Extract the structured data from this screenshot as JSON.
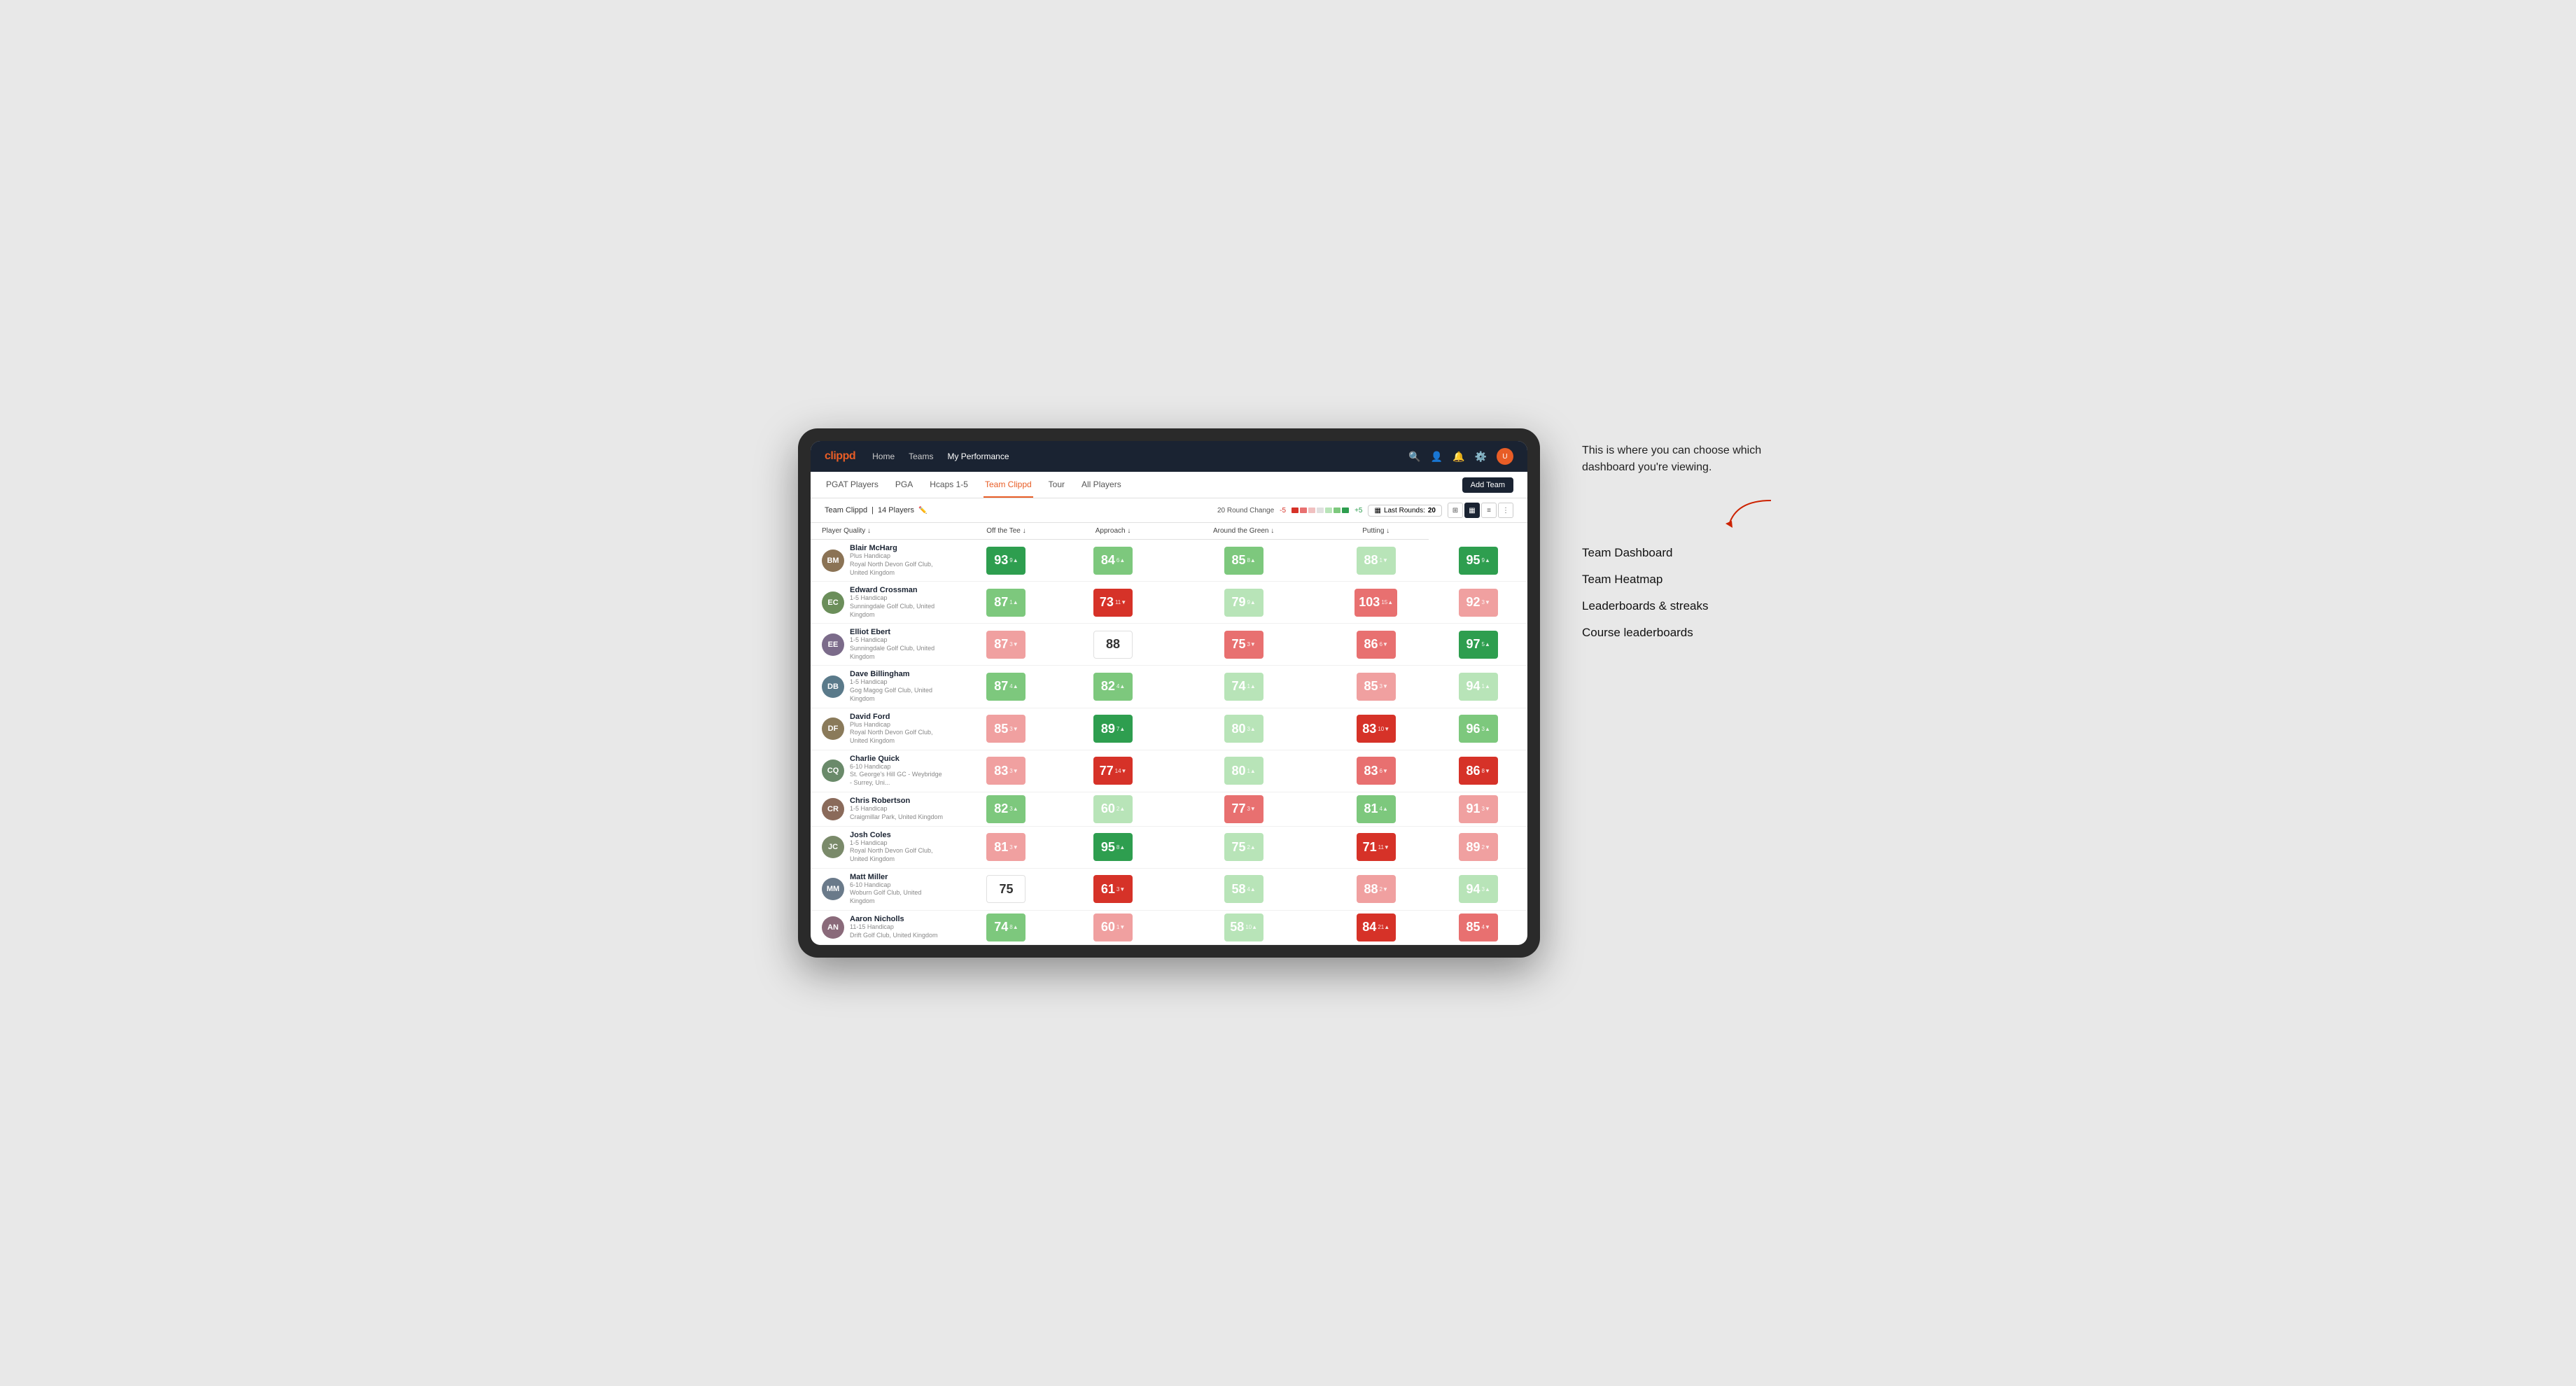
{
  "annotation": {
    "intro_text": "This is where you can choose which dashboard you're viewing.",
    "options": [
      "Team Dashboard",
      "Team Heatmap",
      "Leaderboards & streaks",
      "Course leaderboards"
    ]
  },
  "nav": {
    "logo": "clippd",
    "links": [
      "Home",
      "Teams",
      "My Performance"
    ],
    "active_link": "My Performance"
  },
  "sub_nav": {
    "links": [
      "PGAT Players",
      "PGA",
      "Hcaps 1-5",
      "Team Clippd",
      "Tour",
      "All Players"
    ],
    "active_link": "Team Clippd",
    "add_team_label": "Add Team"
  },
  "team_header": {
    "team_name": "Team Clippd",
    "player_count": "14 Players",
    "round_change_label": "20 Round Change",
    "round_change_low": "-5",
    "round_change_high": "+5",
    "last_rounds_label": "Last Rounds:",
    "last_rounds_value": "20"
  },
  "table": {
    "col_headers": [
      "Player Quality ↓",
      "Off the Tee ↓",
      "Approach ↓",
      "Around the Green ↓",
      "Putting ↓"
    ],
    "rows": [
      {
        "name": "Blair McHarg",
        "handicap": "Plus Handicap",
        "club": "Royal North Devon Golf Club, United Kingdom",
        "initials": "BM",
        "avatar_color": "#8B7355",
        "scores": [
          {
            "value": "93",
            "delta": "9",
            "dir": "up",
            "color": "green-strong"
          },
          {
            "value": "84",
            "delta": "6",
            "dir": "up",
            "color": "green-light"
          },
          {
            "value": "85",
            "delta": "8",
            "dir": "up",
            "color": "green-light"
          },
          {
            "value": "88",
            "delta": "1",
            "dir": "down",
            "color": "green-pale"
          },
          {
            "value": "95",
            "delta": "9",
            "dir": "up",
            "color": "green-strong"
          }
        ]
      },
      {
        "name": "Edward Crossman",
        "handicap": "1-5 Handicap",
        "club": "Sunningdale Golf Club, United Kingdom",
        "initials": "EC",
        "avatar_color": "#6B8E5A",
        "scores": [
          {
            "value": "87",
            "delta": "1",
            "dir": "up",
            "color": "green-light"
          },
          {
            "value": "73",
            "delta": "11",
            "dir": "down",
            "color": "red-strong"
          },
          {
            "value": "79",
            "delta": "9",
            "dir": "up",
            "color": "green-pale"
          },
          {
            "value": "103",
            "delta": "15",
            "dir": "up",
            "color": "red-light"
          },
          {
            "value": "92",
            "delta": "3",
            "dir": "down",
            "color": "red-pale"
          }
        ]
      },
      {
        "name": "Elliot Ebert",
        "handicap": "1-5 Handicap",
        "club": "Sunningdale Golf Club, United Kingdom",
        "initials": "EE",
        "avatar_color": "#7B6B8A",
        "scores": [
          {
            "value": "87",
            "delta": "3",
            "dir": "down",
            "color": "red-pale"
          },
          {
            "value": "88",
            "delta": "",
            "dir": "",
            "color": "white"
          },
          {
            "value": "75",
            "delta": "3",
            "dir": "down",
            "color": "red-light"
          },
          {
            "value": "86",
            "delta": "6",
            "dir": "down",
            "color": "red-light"
          },
          {
            "value": "97",
            "delta": "5",
            "dir": "up",
            "color": "green-strong"
          }
        ]
      },
      {
        "name": "Dave Billingham",
        "handicap": "1-5 Handicap",
        "club": "Gog Magog Golf Club, United Kingdom",
        "initials": "DB",
        "avatar_color": "#5A7A8A",
        "scores": [
          {
            "value": "87",
            "delta": "4",
            "dir": "up",
            "color": "green-light"
          },
          {
            "value": "82",
            "delta": "4",
            "dir": "up",
            "color": "green-light"
          },
          {
            "value": "74",
            "delta": "1",
            "dir": "up",
            "color": "green-pale"
          },
          {
            "value": "85",
            "delta": "3",
            "dir": "down",
            "color": "red-pale"
          },
          {
            "value": "94",
            "delta": "1",
            "dir": "up",
            "color": "green-pale"
          }
        ]
      },
      {
        "name": "David Ford",
        "handicap": "Plus Handicap",
        "club": "Royal North Devon Golf Club, United Kingdom",
        "initials": "DF",
        "avatar_color": "#8A7A5A",
        "scores": [
          {
            "value": "85",
            "delta": "3",
            "dir": "down",
            "color": "red-pale"
          },
          {
            "value": "89",
            "delta": "7",
            "dir": "up",
            "color": "green-strong"
          },
          {
            "value": "80",
            "delta": "3",
            "dir": "up",
            "color": "green-pale"
          },
          {
            "value": "83",
            "delta": "10",
            "dir": "down",
            "color": "red-strong"
          },
          {
            "value": "96",
            "delta": "3",
            "dir": "up",
            "color": "green-light"
          }
        ]
      },
      {
        "name": "Charlie Quick",
        "handicap": "6-10 Handicap",
        "club": "St. George's Hill GC - Weybridge - Surrey, Uni...",
        "initials": "CQ",
        "avatar_color": "#6A8A6A",
        "scores": [
          {
            "value": "83",
            "delta": "3",
            "dir": "down",
            "color": "red-pale"
          },
          {
            "value": "77",
            "delta": "14",
            "dir": "down",
            "color": "red-strong"
          },
          {
            "value": "80",
            "delta": "1",
            "dir": "up",
            "color": "green-pale"
          },
          {
            "value": "83",
            "delta": "6",
            "dir": "down",
            "color": "red-light"
          },
          {
            "value": "86",
            "delta": "8",
            "dir": "down",
            "color": "red-strong"
          }
        ]
      },
      {
        "name": "Chris Robertson",
        "handicap": "1-5 Handicap",
        "club": "Craigmillar Park, United Kingdom",
        "initials": "CR",
        "avatar_color": "#8A6A5A",
        "scores": [
          {
            "value": "82",
            "delta": "3",
            "dir": "up",
            "color": "green-light"
          },
          {
            "value": "60",
            "delta": "2",
            "dir": "up",
            "color": "green-pale"
          },
          {
            "value": "77",
            "delta": "3",
            "dir": "down",
            "color": "red-light"
          },
          {
            "value": "81",
            "delta": "4",
            "dir": "up",
            "color": "green-light"
          },
          {
            "value": "91",
            "delta": "3",
            "dir": "down",
            "color": "red-pale"
          }
        ]
      },
      {
        "name": "Josh Coles",
        "handicap": "1-5 Handicap",
        "club": "Royal North Devon Golf Club, United Kingdom",
        "initials": "JC",
        "avatar_color": "#7A8A6A",
        "scores": [
          {
            "value": "81",
            "delta": "3",
            "dir": "down",
            "color": "red-pale"
          },
          {
            "value": "95",
            "delta": "8",
            "dir": "up",
            "color": "green-strong"
          },
          {
            "value": "75",
            "delta": "2",
            "dir": "up",
            "color": "green-pale"
          },
          {
            "value": "71",
            "delta": "11",
            "dir": "down",
            "color": "red-strong"
          },
          {
            "value": "89",
            "delta": "2",
            "dir": "down",
            "color": "red-pale"
          }
        ]
      },
      {
        "name": "Matt Miller",
        "handicap": "6-10 Handicap",
        "club": "Woburn Golf Club, United Kingdom",
        "initials": "MM",
        "avatar_color": "#6A7A8A",
        "scores": [
          {
            "value": "75",
            "delta": "",
            "dir": "",
            "color": "white"
          },
          {
            "value": "61",
            "delta": "3",
            "dir": "down",
            "color": "red-strong"
          },
          {
            "value": "58",
            "delta": "4",
            "dir": "up",
            "color": "green-pale"
          },
          {
            "value": "88",
            "delta": "2",
            "dir": "down",
            "color": "red-pale"
          },
          {
            "value": "94",
            "delta": "3",
            "dir": "up",
            "color": "green-pale"
          }
        ]
      },
      {
        "name": "Aaron Nicholls",
        "handicap": "11-15 Handicap",
        "club": "Drift Golf Club, United Kingdom",
        "initials": "AN",
        "avatar_color": "#8A6A7A",
        "scores": [
          {
            "value": "74",
            "delta": "8",
            "dir": "up",
            "color": "green-light"
          },
          {
            "value": "60",
            "delta": "1",
            "dir": "down",
            "color": "red-pale"
          },
          {
            "value": "58",
            "delta": "10",
            "dir": "up",
            "color": "green-pale"
          },
          {
            "value": "84",
            "delta": "21",
            "dir": "up",
            "color": "red-strong"
          },
          {
            "value": "85",
            "delta": "4",
            "dir": "down",
            "color": "red-light"
          }
        ]
      }
    ]
  }
}
